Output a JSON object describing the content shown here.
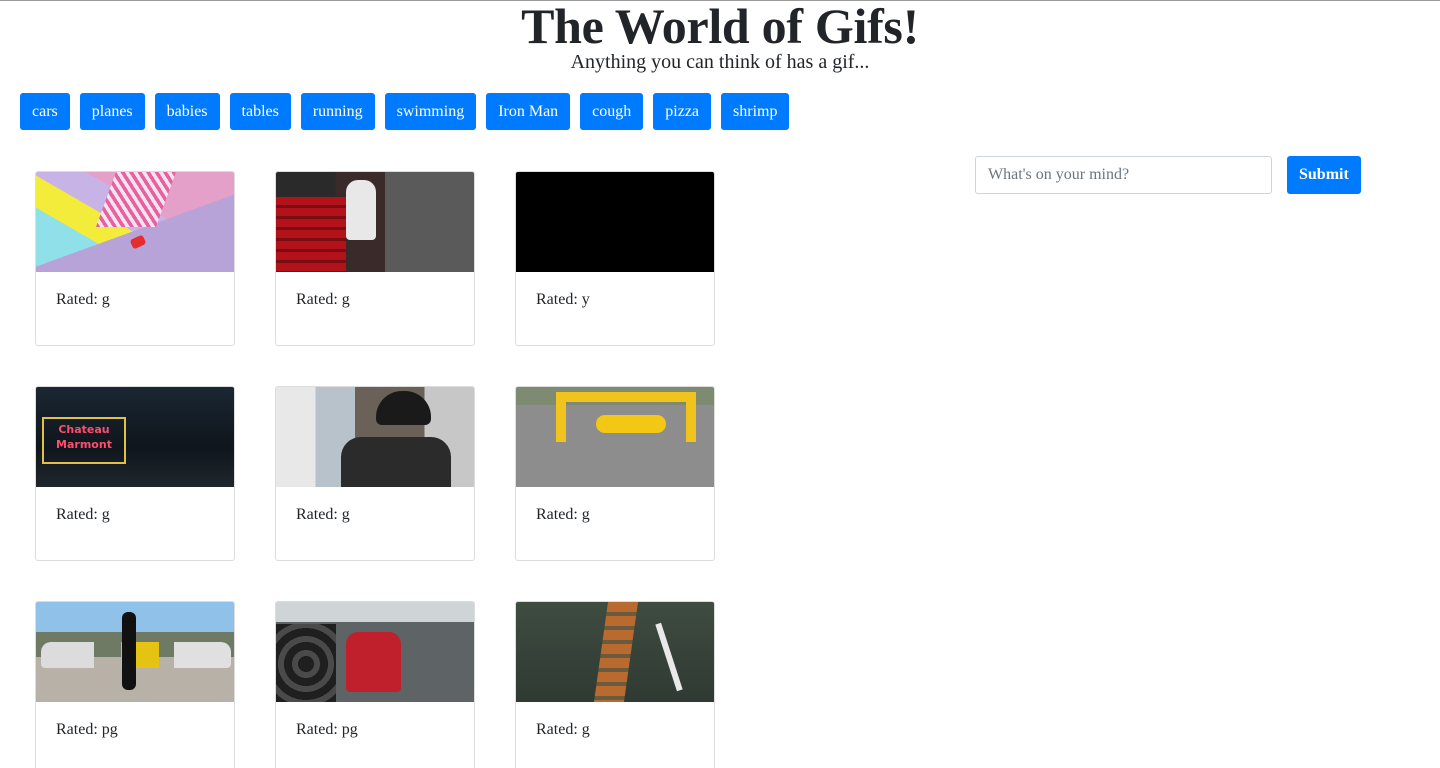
{
  "header": {
    "title": "The World of Gifs!",
    "subtitle": "Anything you can think of has a gif..."
  },
  "topics": [
    "cars",
    "planes",
    "babies",
    "tables",
    "running",
    "swimming",
    "Iron Man",
    "cough",
    "pizza",
    "shrimp"
  ],
  "search": {
    "placeholder": "What's on your mind?",
    "value": "",
    "submit_label": "Submit"
  },
  "gifs": [
    {
      "rating": "Rated: g",
      "thumbnail": "colorful-city-crossing"
    },
    {
      "rating": "Rated: g",
      "thumbnail": "garage-tool-chest"
    },
    {
      "rating": "Rated: y",
      "thumbnail": "black-frame"
    },
    {
      "rating": "Rated: g",
      "thumbnail": "neon-hotel-sign-night"
    },
    {
      "rating": "Rated: g",
      "thumbnail": "man-in-cap-in-car"
    },
    {
      "rating": "Rated: g",
      "thumbnail": "yellow-toy-car-ramp"
    },
    {
      "rating": "Rated: pg",
      "thumbnail": "sports-cars-driveway"
    },
    {
      "rating": "Rated: pg",
      "thumbnail": "junkyard-man-red-shirt"
    },
    {
      "rating": "Rated: g",
      "thumbnail": "road-from-above"
    }
  ],
  "colors": {
    "button": "#007bff",
    "button_text": "#ffffff",
    "card_border": "#dcdcdc"
  }
}
